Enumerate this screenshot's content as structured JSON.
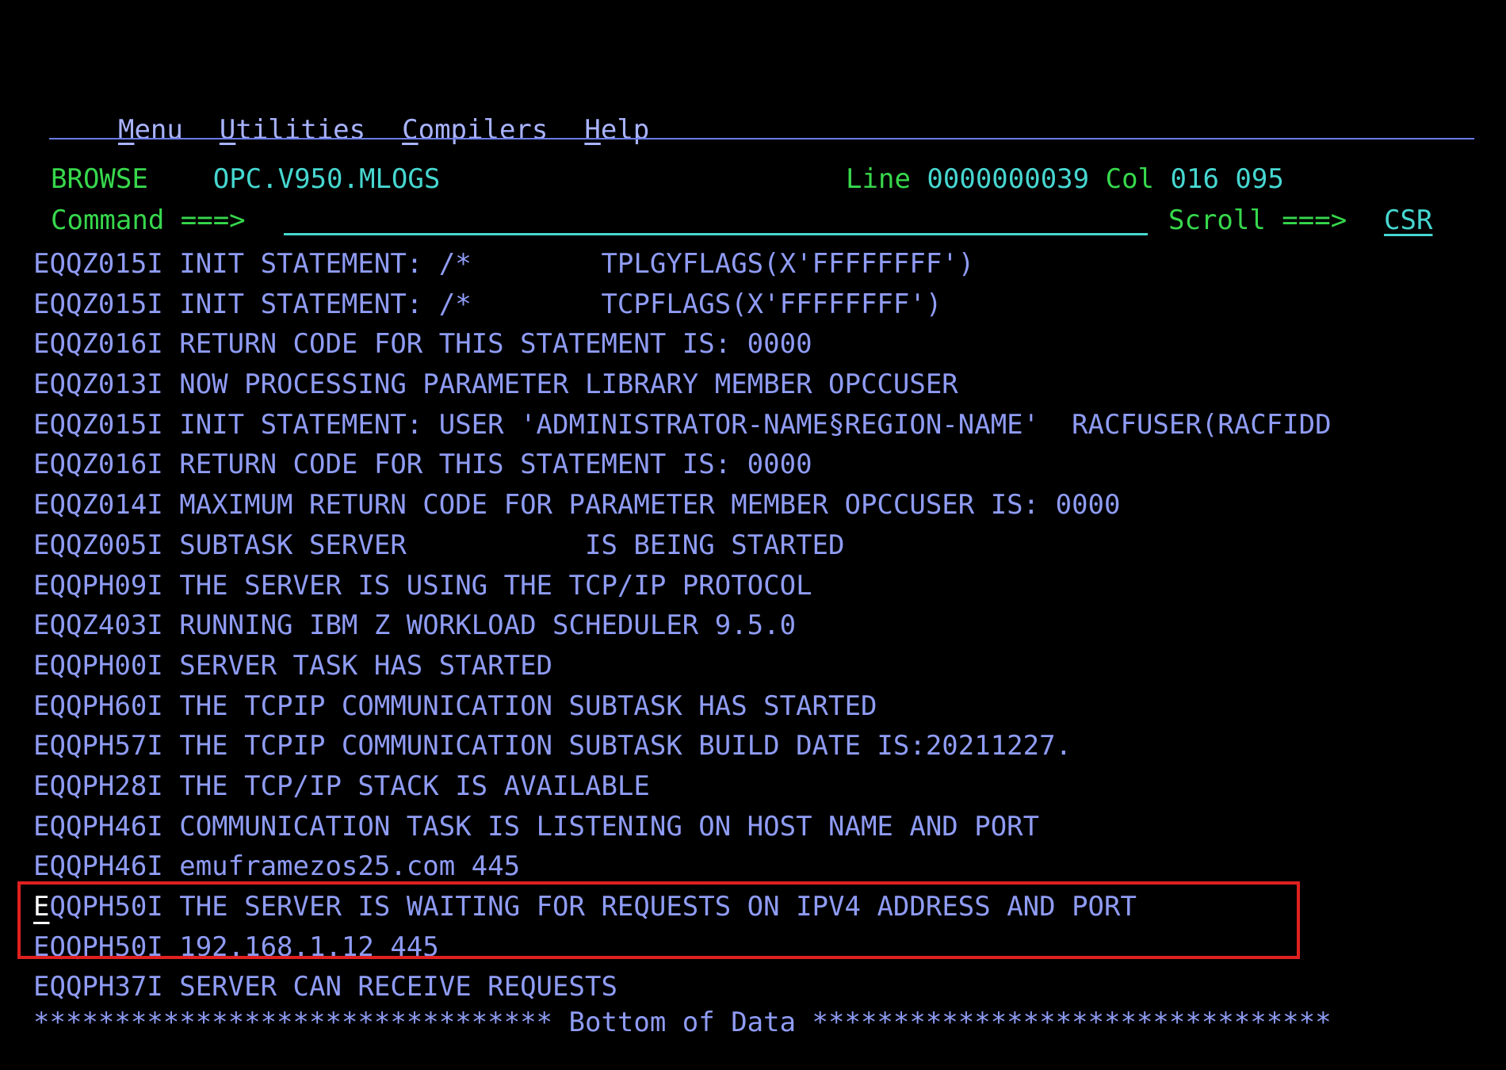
{
  "menu": {
    "items": [
      {
        "mnemonic": "M",
        "rest": "enu"
      },
      {
        "mnemonic": "U",
        "rest": "tilities"
      },
      {
        "mnemonic": "C",
        "rest": "ompilers"
      },
      {
        "mnemonic": "H",
        "rest": "elp"
      }
    ]
  },
  "header": {
    "mode": "BROWSE",
    "dataset": "OPC.V950.MLOGS",
    "line_label": "Line",
    "line_value": "0000000039",
    "col_label": "Col",
    "col_value": "016 095",
    "command_label": "Command ===>",
    "command_value": "",
    "scroll_label": "Scroll ===>",
    "scroll_value": "CSR"
  },
  "log": {
    "lines": [
      "EQQZ015I INIT STATEMENT: /*        TPLGYFLAGS(X'FFFFFFFF')",
      "EQQZ015I INIT STATEMENT: /*        TCPFLAGS(X'FFFFFFFF')",
      "EQQZ016I RETURN CODE FOR THIS STATEMENT IS: 0000",
      "EQQZ013I NOW PROCESSING PARAMETER LIBRARY MEMBER OPCCUSER",
      "EQQZ015I INIT STATEMENT: USER 'ADMINISTRATOR-NAME§REGION-NAME'  RACFUSER(RACFIDD",
      "EQQZ016I RETURN CODE FOR THIS STATEMENT IS: 0000",
      "EQQZ014I MAXIMUM RETURN CODE FOR PARAMETER MEMBER OPCCUSER IS: 0000",
      "EQQZ005I SUBTASK SERVER           IS BEING STARTED",
      "EQQPH09I THE SERVER IS USING THE TCP/IP PROTOCOL",
      "EQQZ403I RUNNING IBM Z WORKLOAD SCHEDULER 9.5.0",
      "EQQPH00I SERVER TASK HAS STARTED",
      "EQQPH60I THE TCPIP COMMUNICATION SUBTASK HAS STARTED",
      "EQQPH57I THE TCPIP COMMUNICATION SUBTASK BUILD DATE IS:20211227.",
      "EQQPH28I THE TCP/IP STACK IS AVAILABLE",
      "EQQPH46I COMMUNICATION TASK IS LISTENING ON HOST NAME AND PORT",
      "EQQPH46I emuframezos25.com 445",
      "EQQPH50I THE SERVER IS WAITING FOR REQUESTS ON IPV4 ADDRESS AND PORT",
      "EQQPH50I 192.168.1.12 445",
      "EQQPH37I SERVER CAN RECEIVE REQUESTS"
    ],
    "bottom_marker": "******************************** Bottom of Data ********************************"
  },
  "colors": {
    "background": "#000000",
    "text_blue": "#8f9cf5",
    "green": "#37d84c",
    "cyan": "#46d7d0",
    "highlight_red": "#e02020"
  }
}
